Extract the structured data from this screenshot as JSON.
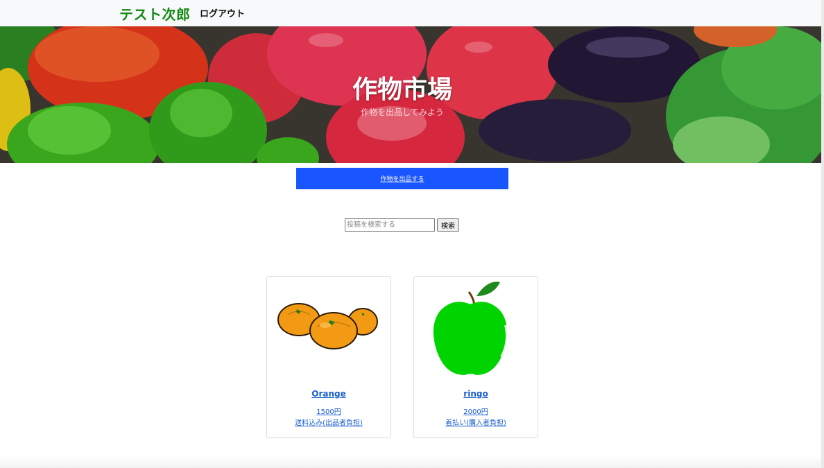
{
  "nav": {
    "brand": "テスト次郎",
    "logout": "ログアウト"
  },
  "hero": {
    "title": "作物市場",
    "subtitle": "作物を出品してみよう"
  },
  "actions": {
    "sell_button": "作物を出品する"
  },
  "search": {
    "placeholder": "投稿を検索する",
    "button": "検索"
  },
  "products": [
    {
      "name": "Orange",
      "price": "1500円",
      "shipping": "送料込み(出品者負担)",
      "image_icon": "orange-fruit-illustration"
    },
    {
      "name": "ringo",
      "price": "2000円",
      "shipping": "着払い(購入者負担)",
      "image_icon": "green-apple-illustration"
    }
  ],
  "colors": {
    "brand": "#138a13",
    "accent_button": "#1a56ff",
    "link": "#1a5fd0",
    "topbar": "#f8f9fa"
  }
}
